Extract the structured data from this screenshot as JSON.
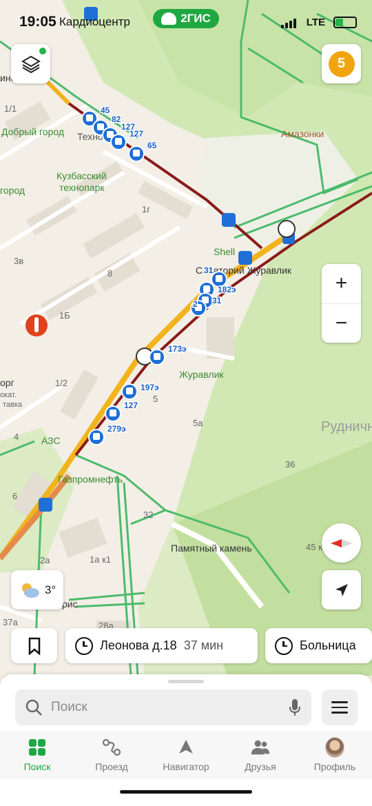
{
  "status_bar": {
    "time": "19:05",
    "location_label": "Кардиоцентр",
    "brand": "2ГИС",
    "network": "LTE"
  },
  "map": {
    "labels": [
      {
        "t": "1/1",
        "cls": "g"
      },
      {
        "t": "Добрый город",
        "cls": "green"
      },
      {
        "t": "Техно",
        "cls": "g"
      },
      {
        "t": "Кузбасский",
        "cls": "green"
      },
      {
        "t": "технопарк",
        "cls": "green"
      },
      {
        "t": "город",
        "cls": "green"
      },
      {
        "t": "1г",
        "cls": "g"
      },
      {
        "t": "3в",
        "cls": "g"
      },
      {
        "t": "8",
        "cls": "g"
      },
      {
        "t": "1Б",
        "cls": "g"
      },
      {
        "t": "Shell",
        "cls": "green"
      },
      {
        "t": "Санаторий Журавлик",
        "cls": "dark"
      },
      {
        "t": "Амазонки",
        "cls": "brown"
      },
      {
        "t": "Журавлик",
        "cls": "green"
      },
      {
        "t": "1/2",
        "cls": "g"
      },
      {
        "t": "5",
        "cls": "g"
      },
      {
        "t": "5а",
        "cls": "g"
      },
      {
        "t": "АЗС",
        "cls": "green"
      },
      {
        "t": "Газпромнефть",
        "cls": "green"
      },
      {
        "t": "Рудничный",
        "cls": "gray"
      },
      {
        "t": "36",
        "cls": "g"
      },
      {
        "t": "32",
        "cls": "g"
      },
      {
        "t": "Памятный камень",
        "cls": "dark"
      },
      {
        "t": "45 к",
        "cls": "g"
      },
      {
        "t": "2а",
        "cls": "g"
      },
      {
        "t": "1а к1",
        "cls": "g"
      },
      {
        "t": "37а",
        "cls": "g"
      },
      {
        "t": "28а",
        "cls": "g"
      },
      {
        "t": "рис",
        "cls": "dark"
      },
      {
        "t": "орг",
        "cls": "dark"
      },
      {
        "t": "окат.",
        "cls": "g"
      },
      {
        "t": "тавка",
        "cls": "g"
      },
      {
        "t": "4",
        "cls": "g"
      },
      {
        "t": "6",
        "cls": "g"
      },
      {
        "t": "инователь",
        "cls": "dark"
      }
    ],
    "bus_routes": [
      "45",
      "82",
      "127",
      "127",
      "65",
      "31",
      "182э",
      "31",
      "2",
      "173э",
      "197э",
      "127",
      "279э"
    ]
  },
  "buttons": {
    "zoom_in": "+",
    "zoom_out": "−",
    "badge_count": "5"
  },
  "weather": {
    "temperature": "3°",
    "icon": "partly-cloudy-icon"
  },
  "chips": [
    {
      "label": "Леонова д.18",
      "eta": "37 мин"
    },
    {
      "label": "Больница",
      "eta": ""
    }
  ],
  "search": {
    "placeholder": "Поиск"
  },
  "tabs": [
    {
      "label": "Поиск",
      "icon": "grid-icon",
      "active": true
    },
    {
      "label": "Проезд",
      "icon": "route-icon",
      "active": false
    },
    {
      "label": "Навигатор",
      "icon": "navigator-icon",
      "active": false
    },
    {
      "label": "Друзья",
      "icon": "friends-icon",
      "active": false
    },
    {
      "label": "Профиль",
      "icon": "avatar",
      "active": false
    }
  ],
  "colors": {
    "accent": "#1fa842",
    "badge": "#f2a40e",
    "traffic_red": "#8b1a1a",
    "traffic_yellow": "#f2b31c",
    "bus": "#1f6fd6"
  }
}
